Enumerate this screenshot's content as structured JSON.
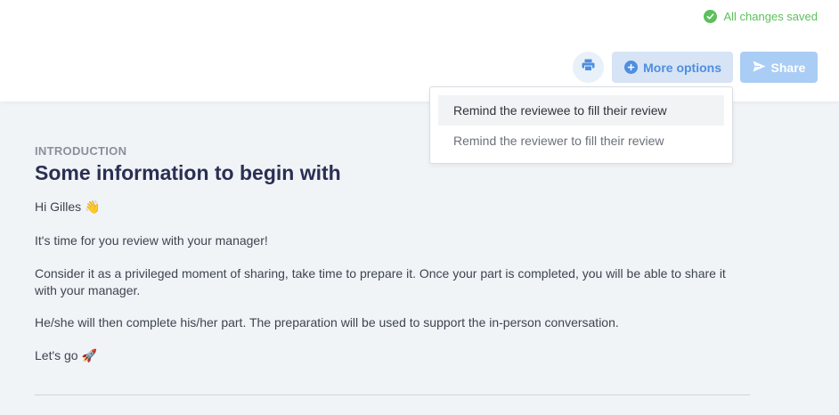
{
  "status": {
    "saved_text": "All changes saved",
    "color": "#5cc05c",
    "icon": "check-circle-icon"
  },
  "toolbar": {
    "print_icon": "printer-icon",
    "more_options_label": "More options",
    "share_label": "Share"
  },
  "dropdown": {
    "items": [
      {
        "label": "Remind the reviewee to fill their review"
      },
      {
        "label": "Remind the reviewer to fill their review"
      }
    ]
  },
  "intro": {
    "section_label": "INTRODUCTION",
    "title": "Some information to begin with",
    "greeting": "Hi Gilles",
    "greeting_emoji": "👋",
    "p1": "It's time for you review with your manager!",
    "p2": "Consider it as a privileged moment of sharing, take time to prepare it. Once your part is completed, you will be able to share it with your manager.",
    "p3": "He/she will then complete his/her part. The preparation will be used to support the in-person conversation.",
    "closing": "Let's go",
    "closing_emoji": "🚀"
  },
  "colors": {
    "accent": "#4f8ee0",
    "share_button": "#a9cdf4",
    "title": "#2b2f52",
    "content_bg": "#f1f4f7"
  }
}
